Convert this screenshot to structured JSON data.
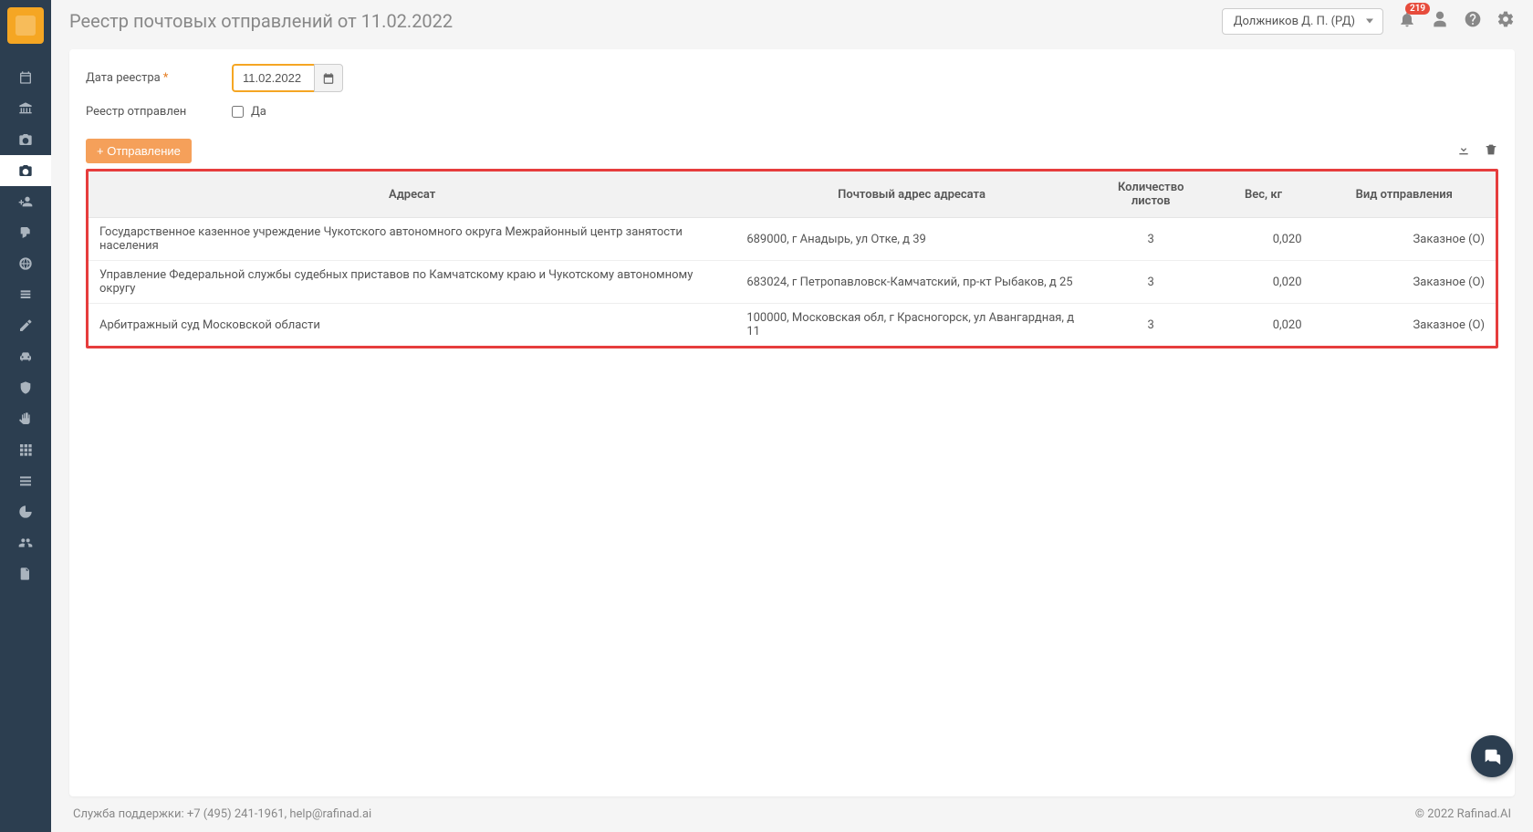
{
  "page": {
    "title": "Реестр почтовых отправлений от 11.02.2022"
  },
  "header": {
    "user": "Должников Д. П. (РД)",
    "notifications_count": "219"
  },
  "form": {
    "date_label": "Дата реестра",
    "date_value": "11.02.2022",
    "sent_label": "Реестр отправлен",
    "sent_checkbox_label": "Да",
    "add_button": "+ Отправление"
  },
  "table": {
    "columns": {
      "addressee": "Адресат",
      "postal": "Почтовый адрес адресата",
      "sheets": "Количество листов",
      "weight": "Вес, кг",
      "type": "Вид отправления"
    },
    "rows": [
      {
        "addressee": "Государственное казенное учреждение Чукотского автономного округа Межрайонный центр занятости населения",
        "postal": "689000, г Анадырь, ул Отке, д 39",
        "sheets": "3",
        "weight": "0,020",
        "type": "Заказное (О)"
      },
      {
        "addressee": "Управление Федеральной службы судебных приставов по Камчатскому краю и Чукотскому автономному округу",
        "postal": "683024, г Петропавловск-Камчатский, пр-кт Рыбаков, д 25",
        "sheets": "3",
        "weight": "0,020",
        "type": "Заказное (О)"
      },
      {
        "addressee": "Арбитражный суд Московской области",
        "postal": "100000, Московская обл, г Красногорск, ул Авангардная, д 11",
        "sheets": "3",
        "weight": "0,020",
        "type": "Заказное (О)"
      }
    ]
  },
  "footer": {
    "support": "Служба поддержки: +7 (495) 241-1961, help@rafinad.ai",
    "copyright": "© 2022  Rafinad.AI"
  }
}
